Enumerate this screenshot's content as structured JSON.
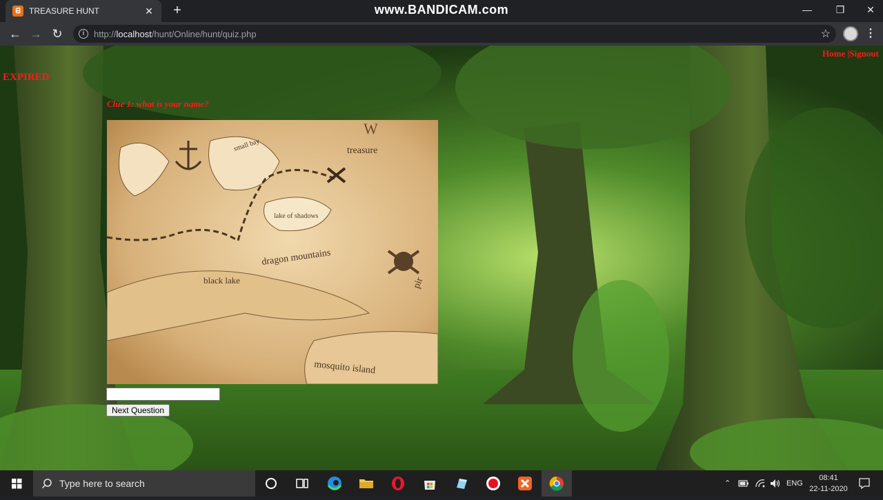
{
  "browser": {
    "tab_title": "TREASURE HUNT",
    "tab_close": "✕",
    "new_tab": "+",
    "watermark": "www.BANDICAM.com",
    "url_prefix": "http://",
    "url_host": "localhost",
    "url_path": "/hunt/Online/hunt/quiz.php",
    "window_controls": {
      "minimize": "—",
      "maximize": "❐",
      "close": "✕"
    }
  },
  "page": {
    "status": "EXPIRED",
    "nav_home": "Home",
    "nav_sep": " |",
    "nav_signout": "Signout",
    "clue": "Clue 1: what is your name?",
    "answer_value": "",
    "next_button": "Next Question",
    "map_labels": {
      "bay": "small bay",
      "treasure": "treasure",
      "compass_w": "W",
      "lake": "lake of shadows",
      "mountains": "dragon mountains",
      "black_lake": "black lake",
      "island": "mosquito island",
      "pir": "pir"
    }
  },
  "taskbar": {
    "search_placeholder": "Type here to search",
    "language": "ENG",
    "time": "08:41",
    "date": "22-11-2020",
    "pinned_icons": [
      "cortana-icon",
      "task-view-icon",
      "edge-icon",
      "file-explorer-icon",
      "opera-icon",
      "store-icon",
      "app-icon",
      "bandicam-record-icon",
      "xampp-icon",
      "chrome-icon"
    ]
  },
  "colors": {
    "accent_red": "#ff1a1a",
    "chrome_dark": "#202124",
    "chrome_toolbar": "#35363a",
    "taskbar": "#1f1f1f"
  }
}
